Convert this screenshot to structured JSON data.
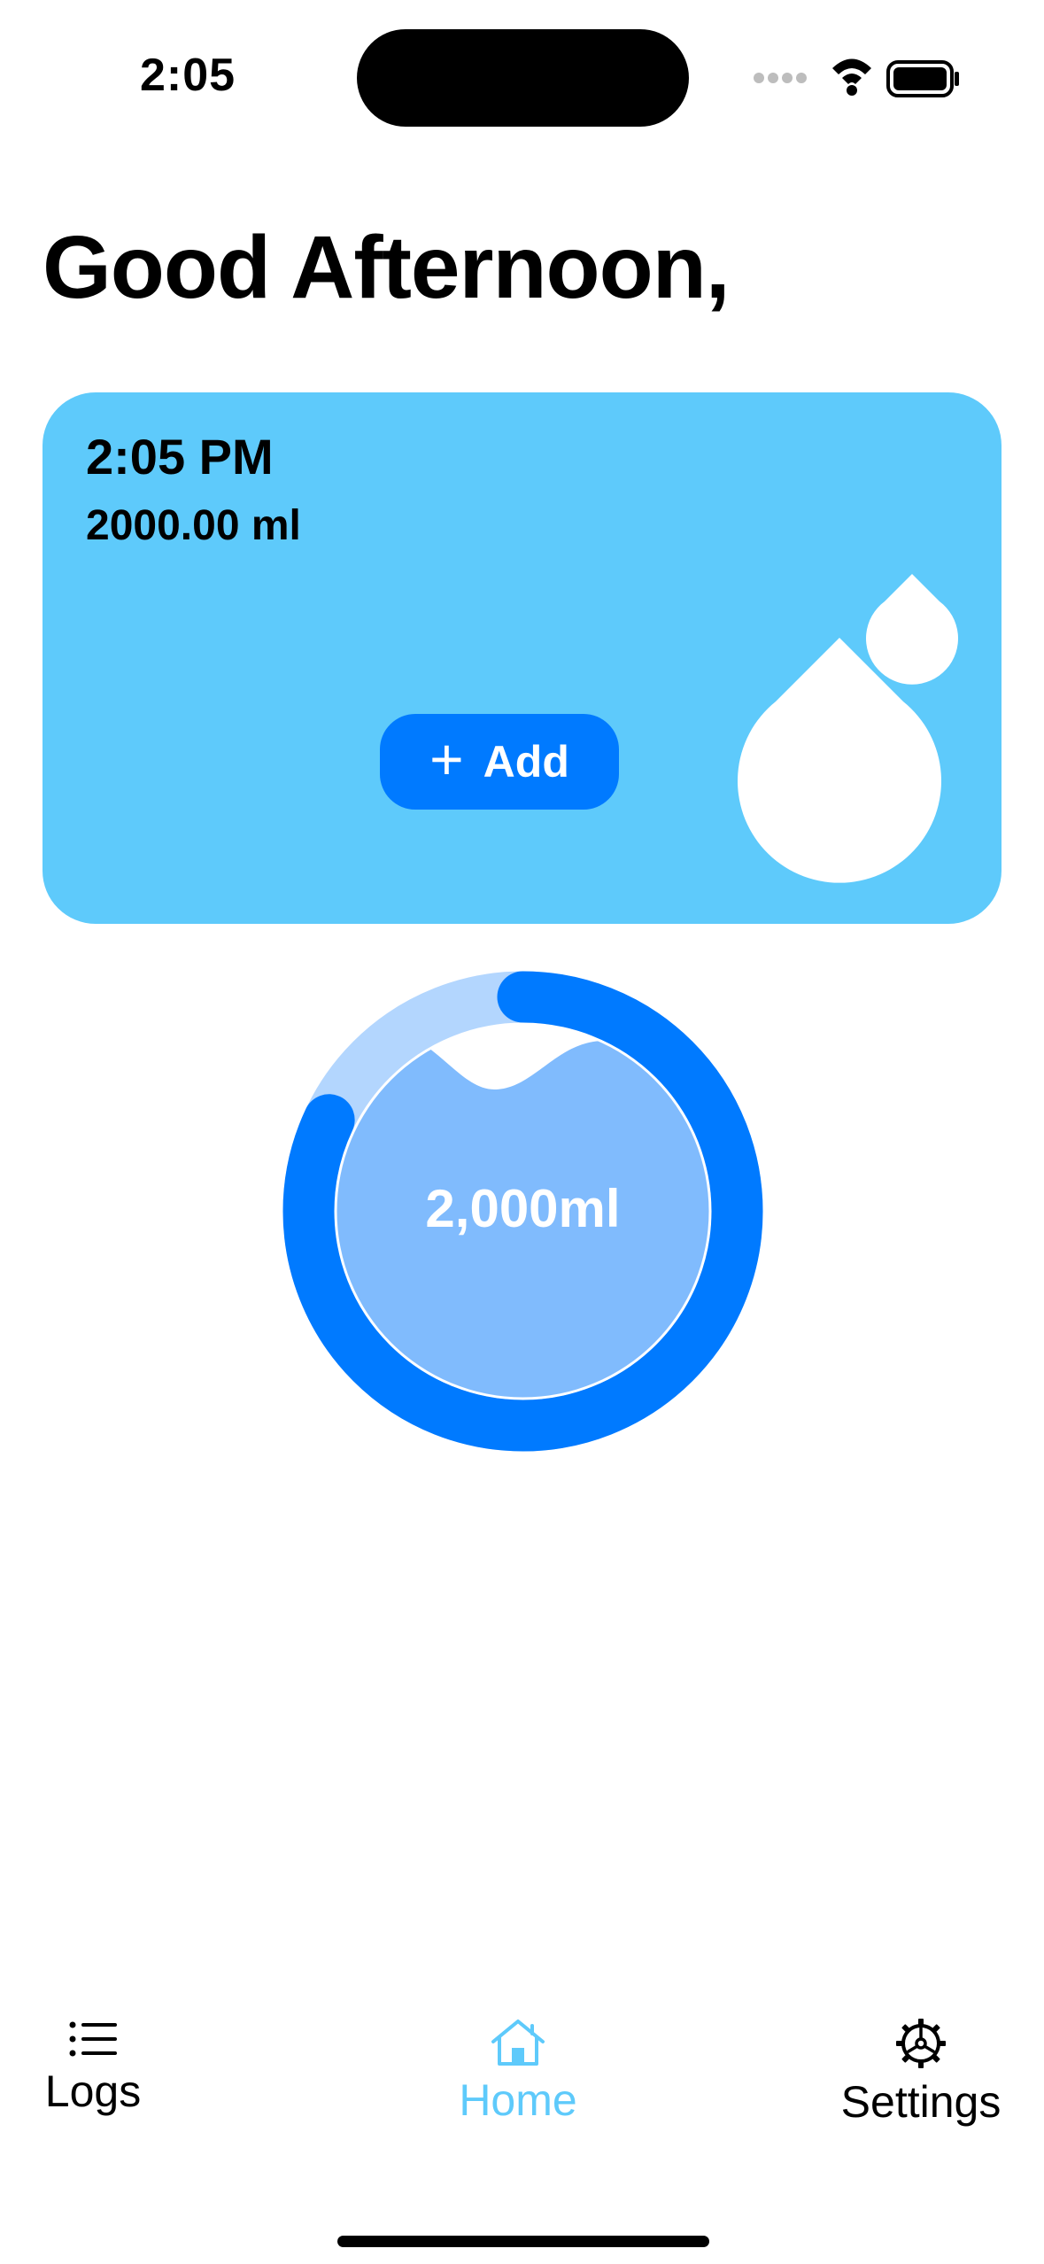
{
  "status_bar": {
    "time": "2:05",
    "icons": [
      "cellular-icon",
      "wifi-icon",
      "battery-icon"
    ]
  },
  "greeting": "Good Afternoon,",
  "card": {
    "time": "2:05 PM",
    "amount": "2000.00 ml",
    "add_label": "Add",
    "add_icon": "plus-icon",
    "background_color": "#5ecafb",
    "button_color": "#007aff"
  },
  "progress": {
    "label": "2,000ml",
    "fraction": 0.82,
    "ring_color": "#007aff",
    "track_color": "#b3d6fe",
    "fill_color": "#80bbfd"
  },
  "tab_bar": {
    "items": [
      {
        "label": "Logs",
        "icon": "list-icon",
        "active": false
      },
      {
        "label": "Home",
        "icon": "house-icon",
        "active": true
      },
      {
        "label": "Settings",
        "icon": "gear-icon",
        "active": false
      }
    ],
    "active_color": "#5ecafb"
  }
}
